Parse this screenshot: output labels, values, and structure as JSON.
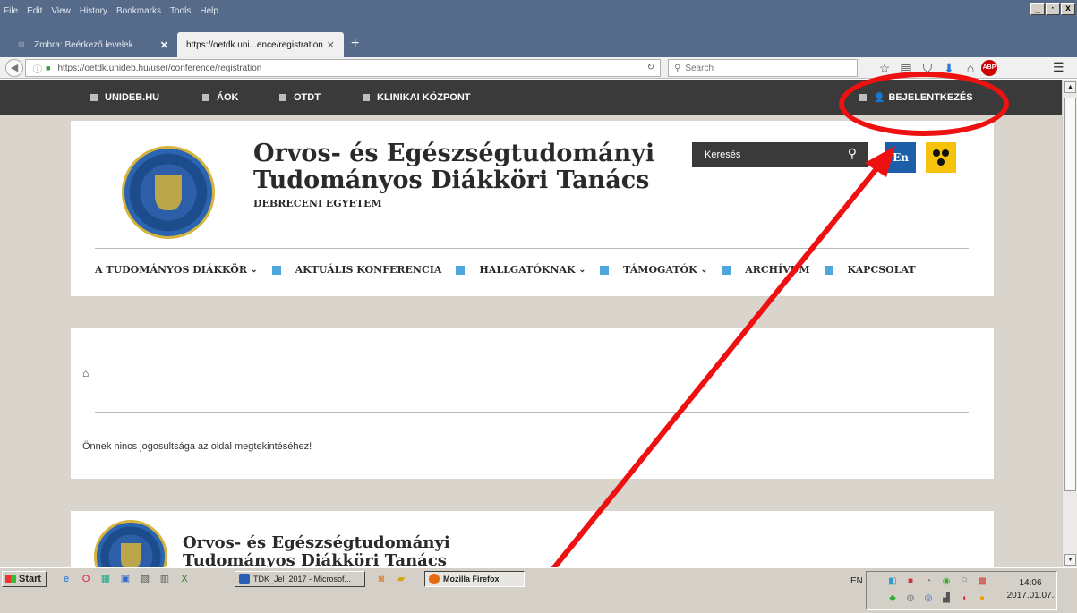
{
  "browser": {
    "menu": [
      "File",
      "Edit",
      "View",
      "History",
      "Bookmarks",
      "Tools",
      "Help"
    ],
    "window_buttons": [
      "_",
      "·",
      "x"
    ],
    "tabs": [
      {
        "title": "Zmbra: Beérkező levelek",
        "active": false
      },
      {
        "title": "https://oetdk.uni...ence/registration",
        "active": true
      }
    ],
    "new_tab": "+",
    "url": "https://oetdk.unideb.hu/user/conference/registration",
    "search_placeholder": "Search",
    "toolbar_icons": [
      "star-icon",
      "reading-list-icon",
      "pocket-icon",
      "download-icon",
      "home-icon",
      "adblock-icon",
      "menu-icon"
    ],
    "abp_label": "ABP"
  },
  "site": {
    "topnav": [
      "UNIDEB.HU",
      "ÁOK",
      "OTDT",
      "KLINIKAI KÖZPONT"
    ],
    "login": "BEJELENTKEZÉS",
    "title_line1": "Orvos- és Egészségtudományi",
    "title_line2": "Tudományos Diákköri Tanács",
    "subtitle": "DEBRECENI EGYETEM",
    "search_placeholder": "Keresés",
    "lang_button": "En",
    "mainnav": [
      {
        "label": "A TUDOMÁNYOS DIÁKKÖR",
        "dropdown": true
      },
      {
        "label": "AKTUÁLIS KONFERENCIA",
        "dropdown": false
      },
      {
        "label": "HALLGATÓKNAK",
        "dropdown": true
      },
      {
        "label": "TÁMOGATÓK",
        "dropdown": true
      },
      {
        "label": "ARCHÍVUM",
        "dropdown": false
      },
      {
        "label": "KAPCSOLAT",
        "dropdown": false
      }
    ],
    "message": "Önnek nincs jogosultsága az oldal megtekintéséhez!",
    "footer_title_line1": "Orvos- és Egészségtudományi",
    "footer_title_line2": "Tudományos Diákköri Tanács"
  },
  "colors": {
    "nav_dark": "#3a3a3a",
    "accent_blue": "#4ea6dc",
    "en_button": "#1c5ea8",
    "a11y_yellow": "#f6c20b",
    "annotation_red": "#ee1111"
  },
  "taskbar": {
    "start": "Start",
    "items": [
      "TDK_Jel_2017 - Microsof...",
      "Mozilla Firefox"
    ],
    "lang": "EN",
    "time": "14:06",
    "date": "2017.01.07."
  }
}
